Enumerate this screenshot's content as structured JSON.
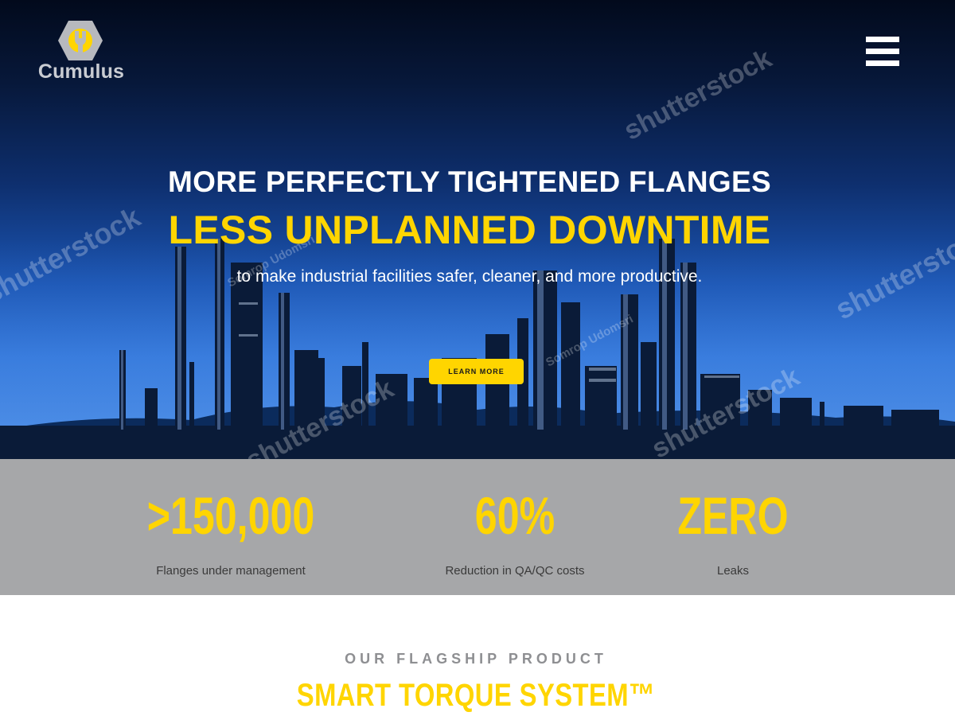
{
  "brand": {
    "name": "Cumulus",
    "accent_color": "#ffd500",
    "logo_icon": "hex-wrench-icon"
  },
  "nav": {
    "menu_icon": "hamburger-menu-icon"
  },
  "hero": {
    "headline_1": "MORE PERFECTLY TIGHTENED FLANGES",
    "headline_2": "LESS UNPLANNED DOWNTIME",
    "subheadline": "to make industrial facilities safer, cleaner, and more productive.",
    "cta_label": "LEARN MORE",
    "watermark_text": "shutterstock",
    "watermark_credit": "Somrop Udomsri"
  },
  "stats": [
    {
      "value": ">150,000",
      "label": "Flanges under management"
    },
    {
      "value": "60%",
      "label": "Reduction in QA/QC costs"
    },
    {
      "value": "ZERO",
      "label": "Leaks"
    }
  ],
  "product": {
    "eyebrow": "OUR FLAGSHIP PRODUCT",
    "title": "SMART TORQUE SYSTEM™"
  }
}
